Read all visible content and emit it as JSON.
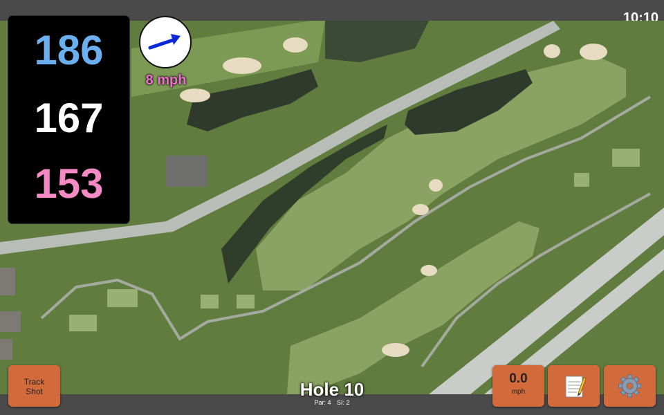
{
  "status": {
    "time": "10:10"
  },
  "yardage": {
    "back": "186",
    "middle": "167",
    "front": "153"
  },
  "wind": {
    "speed_label": "8 mph",
    "direction_icon": "arrow-right-icon"
  },
  "hole": {
    "title": "Hole 10",
    "par": "Par: 4",
    "stroke_index": "SI: 2"
  },
  "buttons": {
    "track_shot_line1": "Track",
    "track_shot_line2": "Shot",
    "speed_value": "0.0",
    "speed_unit": "mph",
    "notes_icon": "notepad-icon",
    "settings_icon": "gear-icon"
  },
  "colors": {
    "back_distance": "#6ab0f0",
    "middle_distance": "#ffffff",
    "front_distance": "#f48ac4",
    "wind_speed": "#f070d0",
    "button": "#d26a3c"
  }
}
